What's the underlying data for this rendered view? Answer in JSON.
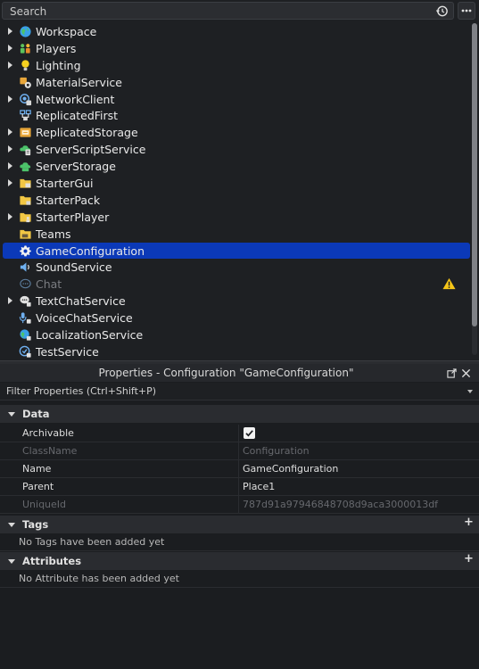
{
  "search": {
    "placeholder": "Search",
    "value": ""
  },
  "explorer": {
    "items": [
      {
        "label": "Workspace",
        "icon": "workspace-icon",
        "expandable": true
      },
      {
        "label": "Players",
        "icon": "players-icon",
        "expandable": true
      },
      {
        "label": "Lighting",
        "icon": "lighting-icon",
        "expandable": true
      },
      {
        "label": "MaterialService",
        "icon": "material-service-icon",
        "expandable": false
      },
      {
        "label": "NetworkClient",
        "icon": "network-client-icon",
        "expandable": true
      },
      {
        "label": "ReplicatedFirst",
        "icon": "replicated-first-icon",
        "expandable": false
      },
      {
        "label": "ReplicatedStorage",
        "icon": "replicated-storage-icon",
        "expandable": true
      },
      {
        "label": "ServerScriptService",
        "icon": "server-script-service-icon",
        "expandable": true
      },
      {
        "label": "ServerStorage",
        "icon": "server-storage-icon",
        "expandable": true
      },
      {
        "label": "StarterGui",
        "icon": "starter-gui-icon",
        "expandable": true
      },
      {
        "label": "StarterPack",
        "icon": "starter-pack-icon",
        "expandable": false
      },
      {
        "label": "StarterPlayer",
        "icon": "starter-player-icon",
        "expandable": true
      },
      {
        "label": "Teams",
        "icon": "teams-icon",
        "expandable": false
      },
      {
        "label": "GameConfiguration",
        "icon": "gear-icon",
        "expandable": false,
        "selected": true
      },
      {
        "label": "SoundService",
        "icon": "sound-service-icon",
        "expandable": false
      },
      {
        "label": "Chat",
        "icon": "chat-icon",
        "expandable": false,
        "dimmed": true,
        "warning": true
      },
      {
        "label": "TextChatService",
        "icon": "text-chat-service-icon",
        "expandable": true
      },
      {
        "label": "VoiceChatService",
        "icon": "voice-chat-service-icon",
        "expandable": false
      },
      {
        "label": "LocalizationService",
        "icon": "localization-service-icon",
        "expandable": false
      },
      {
        "label": "TestService",
        "icon": "test-service-icon",
        "expandable": false
      }
    ]
  },
  "properties": {
    "title": "Properties - Configuration \"GameConfiguration\"",
    "filter_placeholder": "Filter Properties (Ctrl+Shift+P)",
    "sections": {
      "data": {
        "title": "Data",
        "rows": [
          {
            "name": "Archivable",
            "value": "",
            "checked": true,
            "disabled": false
          },
          {
            "name": "ClassName",
            "value": "Configuration",
            "disabled": true
          },
          {
            "name": "Name",
            "value": "GameConfiguration",
            "disabled": false
          },
          {
            "name": "Parent",
            "value": "Place1",
            "disabled": false
          },
          {
            "name": "UniqueId",
            "value": "787d91a97946848708d9aca3000013df",
            "disabled": true
          }
        ]
      },
      "tags": {
        "title": "Tags",
        "plus": "+",
        "empty": "No Tags have been added yet"
      },
      "attributes": {
        "title": "Attributes",
        "plus": "+",
        "empty": "No Attribute has been added yet"
      }
    }
  },
  "colors": {
    "selection": "#0b39b8",
    "panel_bg": "#1e2023",
    "warning": "#f5c518"
  }
}
